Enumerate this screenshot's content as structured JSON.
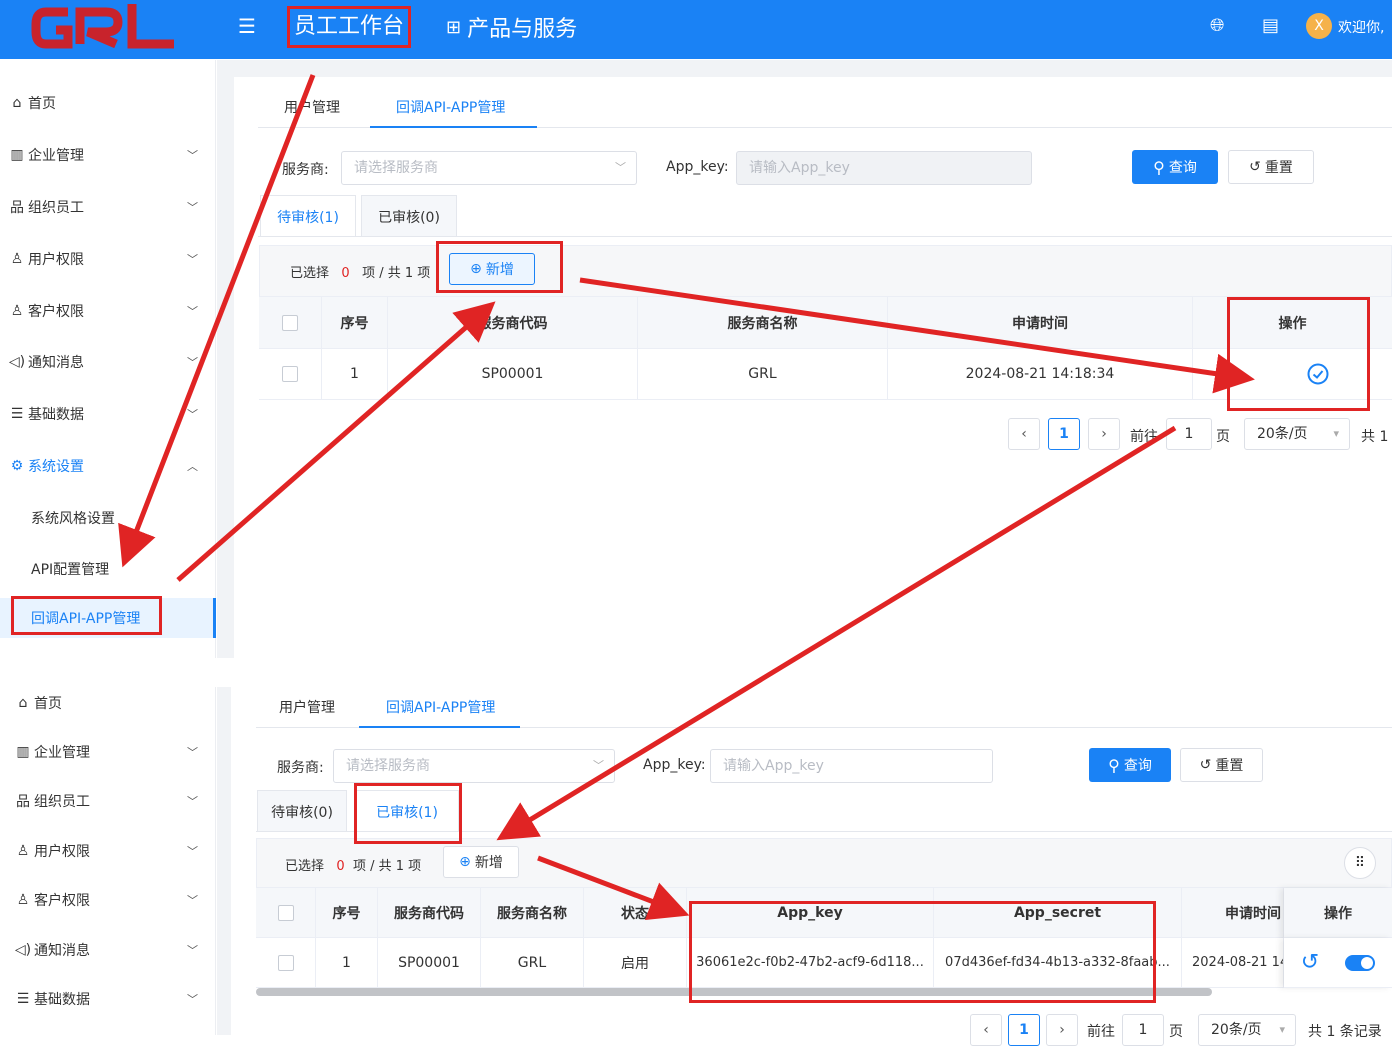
{
  "header": {
    "logo_text": "GRL",
    "workspace_title": "员工工作台",
    "products_label": "产品与服务",
    "welcome_text": "欢迎你, ",
    "avatar_letter": "X"
  },
  "sidebar_top": {
    "items": [
      {
        "label": "首页"
      },
      {
        "label": "企业管理"
      },
      {
        "label": "组织员工"
      },
      {
        "label": "用户权限"
      },
      {
        "label": "客户权限"
      },
      {
        "label": "通知消息"
      },
      {
        "label": "基础数据"
      },
      {
        "label": "系统设置"
      }
    ],
    "sub_items": [
      {
        "label": "系统风格设置"
      },
      {
        "label": "API配置管理"
      },
      {
        "label": "回调API-APP管理"
      }
    ]
  },
  "sidebar_bottom": {
    "items": [
      {
        "label": "首页"
      },
      {
        "label": "企业管理"
      },
      {
        "label": "组织员工"
      },
      {
        "label": "用户权限"
      },
      {
        "label": "客户权限"
      },
      {
        "label": "通知消息"
      },
      {
        "label": "基础数据"
      }
    ]
  },
  "panel_top": {
    "tabs": [
      "用户管理",
      "回调API-APP管理"
    ],
    "provider_label": "服务商:",
    "provider_placeholder": "请选择服务商",
    "appkey_label": "App_key:",
    "appkey_placeholder": "请输入App_key",
    "query_label": "查询",
    "reset_label": "重置",
    "subtabs": [
      "待审核(1)",
      "已审核(0)"
    ],
    "selected_prefix": "已选择",
    "selected_count": "0",
    "selected_suffix": "项 / 共 1 项",
    "add_label": "新增",
    "columns": [
      "序号",
      "服务商代码",
      "服务商名称",
      "申请时间",
      "操作"
    ],
    "rows": [
      {
        "index": "1",
        "code": "SP00001",
        "name": "GRL",
        "time": "2024-08-21 14:18:34"
      }
    ],
    "pagination": {
      "current": "1",
      "goto_label": "前往",
      "goto_value": "1",
      "page_unit": "页",
      "page_size": "20条/页",
      "total": "共 1"
    }
  },
  "panel_bottom": {
    "tabs": [
      "用户管理",
      "回调API-APP管理"
    ],
    "provider_label": "服务商:",
    "provider_placeholder": "请选择服务商",
    "appkey_label": "App_key:",
    "appkey_placeholder": "请输入App_key",
    "query_label": "查询",
    "reset_label": "重置",
    "subtabs": [
      "待审核(0)",
      "已审核(1)"
    ],
    "selected_prefix": "已选择",
    "selected_count": "0",
    "selected_suffix": "项 / 共 1 项",
    "add_label": "新增",
    "columns": [
      "序号",
      "服务商代码",
      "服务商名称",
      "状态",
      "App_key",
      "App_secret",
      "申请时间",
      "操作"
    ],
    "rows": [
      {
        "index": "1",
        "code": "SP00001",
        "name": "GRL",
        "status": "启用",
        "app_key": "36061e2c-f0b2-47b2-acf9-6d118...",
        "app_secret": "07d436ef-fd34-4b13-a332-8faab...",
        "time": "2024-08-21 14"
      }
    ],
    "pagination": {
      "current": "1",
      "goto_label": "前往",
      "goto_value": "1",
      "page_unit": "页",
      "page_size": "20条/页",
      "total": "共 1 条记录"
    }
  },
  "colors": {
    "primary": "#1a82f5",
    "annotation_red": "#e02424"
  }
}
